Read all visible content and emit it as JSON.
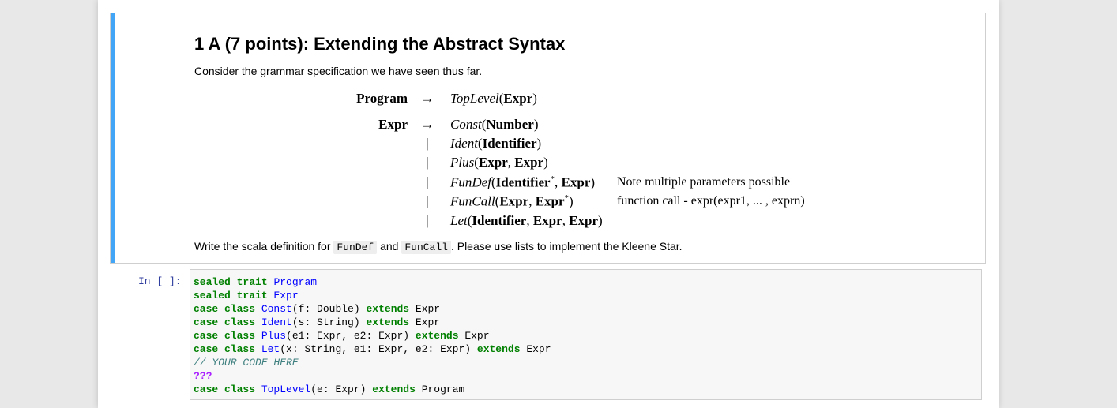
{
  "markdown": {
    "title": "1 A (7 points): Extending the Abstract Syntax",
    "intro": "Consider the grammar specification we have seen thus far.",
    "arrow": "→",
    "bar": "|",
    "grammar": {
      "program_nt": "Program",
      "program_ctor": "TopLevel",
      "program_arg": "Expr",
      "expr_nt": "Expr",
      "p1_ctor": "Const",
      "p1_arg": "Number",
      "p2_ctor": "Ident",
      "p2_arg": "Identifier",
      "p3_ctor": "Plus",
      "p3_arg1": "Expr",
      "p3_arg2": "Expr",
      "p4_ctor": "FunDef",
      "p4_arg1": "Identifier",
      "p4_arg2": "Expr",
      "p4_note": "Note multiple parameters possible",
      "p5_ctor": "FunCall",
      "p5_arg1": "Expr",
      "p5_arg2": "Expr",
      "p5_note": "function call - expr(expr1, ... , exprn)",
      "p6_ctor": "Let",
      "p6_arg1": "Identifier",
      "p6_arg2": "Expr",
      "p6_arg3": "Expr",
      "star": "*"
    },
    "outro_before": "Write the scala definition for",
    "code_fundef": "FunDef",
    "outro_and": "and",
    "code_funcall": "FunCall",
    "outro_after": ". Please use lists to implement the Kleene Star."
  },
  "code_cell": {
    "prompt": "In [ ]:",
    "lines": {
      "l1": {
        "kw": "sealed trait",
        "name": "Program",
        "rest": ""
      },
      "l2": {
        "kw": "sealed trait",
        "name": "Expr",
        "rest": ""
      },
      "l3": {
        "kw": "case class",
        "name": "Const",
        "args": "(f: Double)",
        "ext": "extends",
        "parent": "Expr"
      },
      "l4": {
        "kw": "case class",
        "name": "Ident",
        "args": "(s: String)",
        "ext": "extends",
        "parent": "Expr"
      },
      "l5": {
        "kw": "case class",
        "name": "Plus",
        "args": "(e1: Expr, e2: Expr)",
        "ext": "extends",
        "parent": "Expr"
      },
      "l6": {
        "kw": "case class",
        "name": "Let",
        "args": "(x: String, e1: Expr, e2: Expr)",
        "ext": "extends",
        "parent": "Expr"
      },
      "l7": {
        "comment": "// YOUR CODE HERE"
      },
      "l8": {
        "placeholder": "???"
      },
      "l9": {
        "kw": "case class",
        "name": "TopLevel",
        "args": "(e: Expr)",
        "ext": "extends",
        "parent": "Program"
      }
    }
  }
}
